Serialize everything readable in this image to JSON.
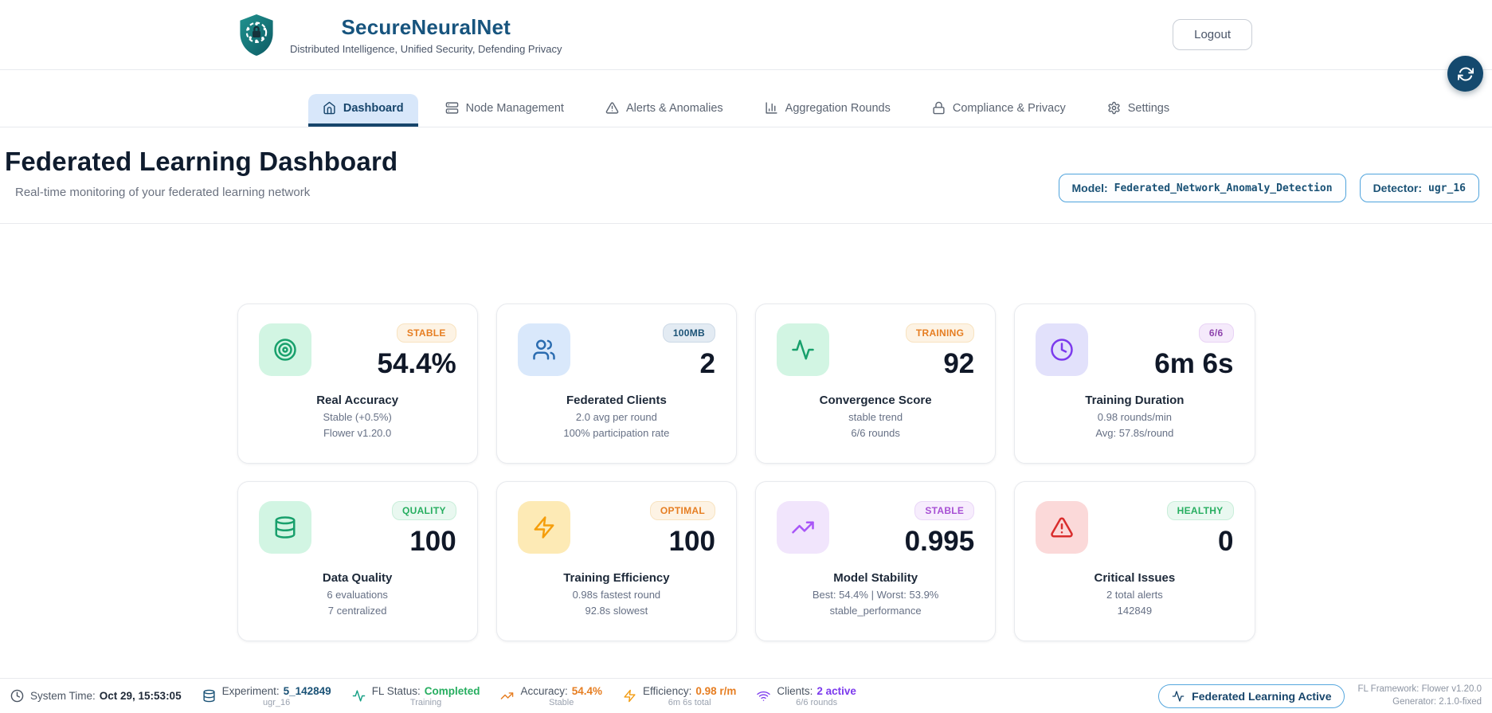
{
  "header": {
    "title": "SecureNeuralNet",
    "tagline": "Distributed Intelligence, Unified Security, Defending Privacy",
    "logout_label": "Logout"
  },
  "nav": {
    "tabs": [
      {
        "label": "Dashboard",
        "icon": "home",
        "active": true
      },
      {
        "label": "Node Management",
        "icon": "server",
        "active": false
      },
      {
        "label": "Alerts & Anomalies",
        "icon": "alert-triangle",
        "active": false
      },
      {
        "label": "Aggregation Rounds",
        "icon": "bar-chart",
        "active": false
      },
      {
        "label": "Compliance & Privacy",
        "icon": "lock",
        "active": false
      },
      {
        "label": "Settings",
        "icon": "gear",
        "active": false
      }
    ]
  },
  "page": {
    "title": "Federated Learning Dashboard",
    "subtitle": "Real-time monitoring of your federated learning network",
    "model_badge": {
      "label": "Model:",
      "value": "Federated_Network_Anomaly_Detection"
    },
    "detector_badge": {
      "label": "Detector:",
      "value": "ugr_16"
    }
  },
  "cards": [
    {
      "icon": "target",
      "tile_theme": "green",
      "badge": "STABLE",
      "badge_theme": "orange",
      "value": "54.4%",
      "title": "Real Accuracy",
      "sub1": "Stable (+0.5%)",
      "sub2": "Flower v1.20.0"
    },
    {
      "icon": "users",
      "tile_theme": "blue",
      "badge": "100MB",
      "badge_theme": "blue",
      "value": "2",
      "title": "Federated Clients",
      "sub1": "2.0 avg per round",
      "sub2": "100% participation rate"
    },
    {
      "icon": "activity",
      "tile_theme": "green",
      "badge": "TRAINING",
      "badge_theme": "orange",
      "value": "92",
      "title": "Convergence Score",
      "sub1": "stable trend",
      "sub2": "6/6 rounds"
    },
    {
      "icon": "clock",
      "tile_theme": "purple",
      "badge": "6/6",
      "badge_theme": "purple",
      "value": "6m 6s",
      "title": "Training Duration",
      "sub1": "0.98 rounds/min",
      "sub2": "Avg: 57.8s/round"
    },
    {
      "icon": "database",
      "tile_theme": "green",
      "badge": "QUALITY",
      "badge_theme": "green",
      "value": "100",
      "title": "Data Quality",
      "sub1": "6 evaluations",
      "sub2": "7 centralized"
    },
    {
      "icon": "zap",
      "tile_theme": "yellow",
      "badge": "OPTIMAL",
      "badge_theme": "orange",
      "value": "100",
      "title": "Training Efficiency",
      "sub1": "0.98s fastest round",
      "sub2": "92.8s slowest"
    },
    {
      "icon": "trending-up",
      "tile_theme": "violet",
      "badge": "STABLE",
      "badge_theme": "violet",
      "value": "0.995",
      "title": "Model Stability",
      "sub1": "Best: 54.4% | Worst: 53.9%",
      "sub2": "stable_performance"
    },
    {
      "icon": "alert-triangle",
      "tile_theme": "red",
      "badge": "HEALTHY",
      "badge_theme": "green",
      "value": "0",
      "title": "Critical Issues",
      "sub1": "2 total alerts",
      "sub2": "142849"
    }
  ],
  "footer": {
    "items": [
      {
        "icon": "clock",
        "icon_color": "gray",
        "label": "System Time:",
        "value": "Oct 29, 15:53:05",
        "value_color": "dark",
        "sub": ""
      },
      {
        "icon": "database",
        "icon_color": "navy",
        "label": "Experiment:",
        "value": "5_142849",
        "value_color": "navy",
        "sub": "ugr_16"
      },
      {
        "icon": "activity",
        "icon_color": "green",
        "label": "FL Status:",
        "value": "Completed",
        "value_color": "green",
        "sub": "Training"
      },
      {
        "icon": "trending-up",
        "icon_color": "orange",
        "label": "Accuracy:",
        "value": "54.4%",
        "value_color": "orange",
        "sub": "Stable"
      },
      {
        "icon": "zap",
        "icon_color": "amber",
        "label": "Efficiency:",
        "value": "0.98 r/m",
        "value_color": "orange",
        "sub": "6m 6s total"
      },
      {
        "icon": "wifi",
        "icon_color": "violet",
        "label": "Clients:",
        "value": "2 active",
        "value_color": "violet",
        "sub": "6/6 rounds"
      }
    ],
    "active_badge": "Federated Learning Active",
    "framework_line1": "FL Framework: Flower v1.20.0",
    "framework_line2": "Generator: 2.1.0-fixed"
  },
  "colors": {
    "brand_navy": "#17547e",
    "active_tab_navy": "#17456b",
    "chip_border_blue": "#4fa3dc",
    "status_green": "#27ae60",
    "status_orange": "#e67e22",
    "status_violet": "#7c3aed",
    "fab_background": "#14496e"
  }
}
